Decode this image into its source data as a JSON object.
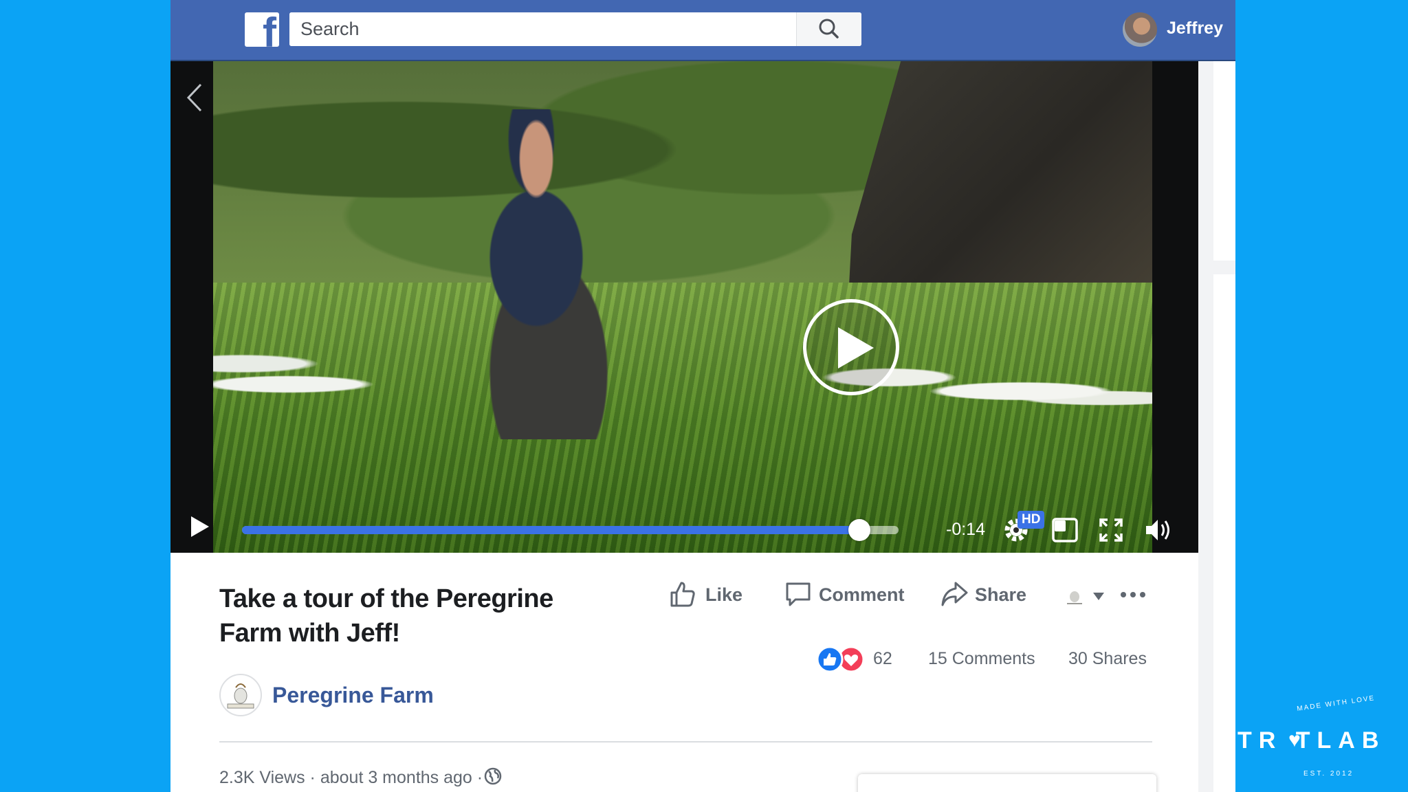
{
  "topbar": {
    "logo": "f",
    "search_placeholder": "Search",
    "user_name": "Jeffrey"
  },
  "video": {
    "time_remaining": "-0:14",
    "progress": 0.94,
    "hd_label": "HD"
  },
  "post": {
    "title": "Take a tour of the Peregrine Farm with Jeff!",
    "actions": {
      "like": "Like",
      "comment": "Comment",
      "share": "Share"
    },
    "reaction_count": "62",
    "comments": "15 Comments",
    "shares": "30 Shares",
    "page_name": "Peregrine Farm",
    "views": "2.3K Views",
    "time_ago": "about 3 months ago"
  },
  "watermark": {
    "brand": "TR TLAB",
    "top_arc": "MADE WITH LOVE",
    "bottom_arc": "EST. 2012"
  },
  "colors": {
    "background": "#0ba3f5",
    "facebook_blue": "#4267b2",
    "progress": "#3b72e6",
    "link": "#385898"
  }
}
